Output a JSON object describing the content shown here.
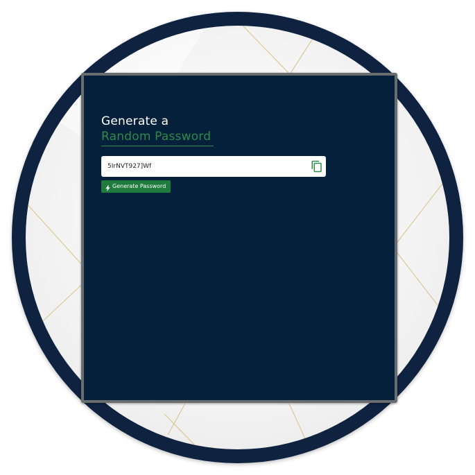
{
  "colors": {
    "panel_background": "#04203a",
    "panel_border": "#6a6d70",
    "ring": "#0f2340",
    "accent_green": "#2e8a4a",
    "button_green": "#1f7a3d",
    "gold_lines": "#d9c48a"
  },
  "generator": {
    "title_line1": "Generate a",
    "title_line2": "Random Password",
    "password_value": "5IrNVT927]Wf",
    "copy_icon": "copy-icon",
    "generate_icon": "bolt-icon",
    "generate_label": "Generate Password"
  }
}
